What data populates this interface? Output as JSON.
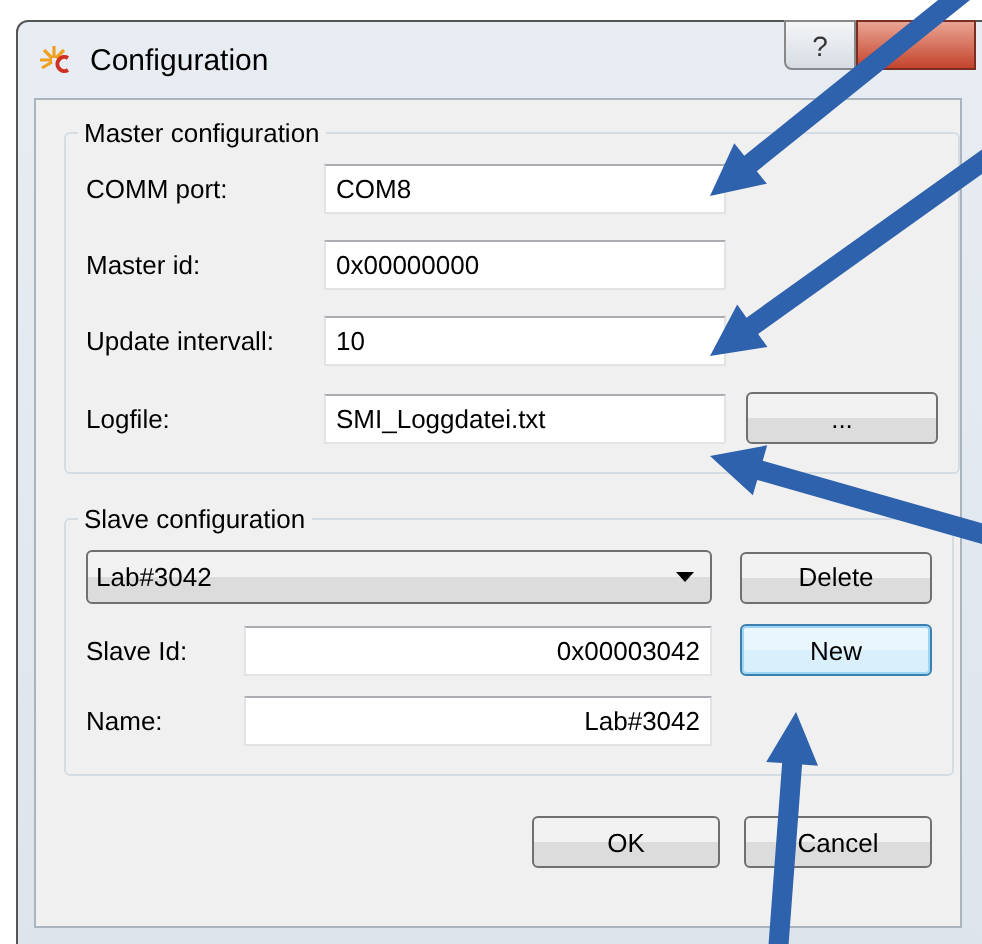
{
  "window": {
    "title": "Configuration",
    "help_button": "?"
  },
  "master": {
    "title": "Master configuration",
    "fields": [
      {
        "label": "COMM port:",
        "value": "COM8"
      },
      {
        "label": "Master id:",
        "value": "0x00000000"
      },
      {
        "label": "Update intervall:",
        "value": "10"
      },
      {
        "label": "Logfile:",
        "value": "SMI_Loggdatei.txt",
        "button": "..."
      }
    ]
  },
  "slave": {
    "title": "Slave configuration",
    "dropdown": {
      "value": "Lab#3042"
    },
    "delete_button": "Delete",
    "new_button": {
      "label": "New",
      "focused": true
    },
    "fields": [
      {
        "label": "Slave Id:",
        "value": "0x00003042"
      },
      {
        "label": "Name:",
        "value": "Lab#3042"
      }
    ]
  },
  "buttons": [
    {
      "label": "OK"
    },
    {
      "label": "Cancel"
    }
  ]
}
